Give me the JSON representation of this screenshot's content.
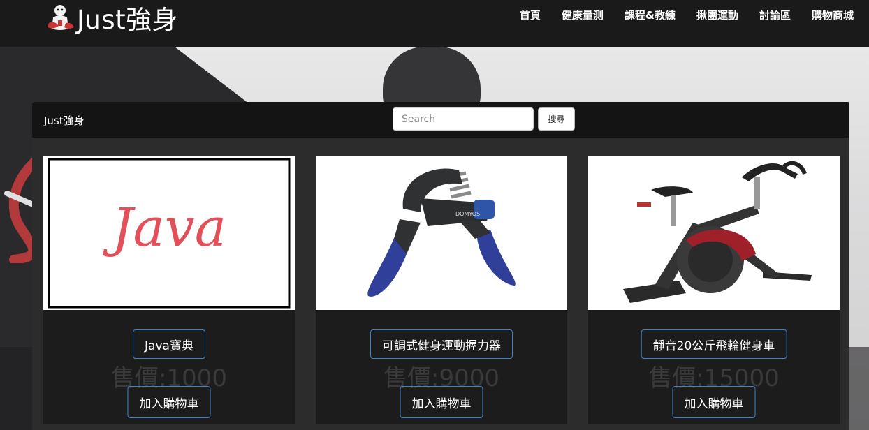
{
  "header": {
    "brand": "Just強身",
    "nav": [
      {
        "label": "首頁"
      },
      {
        "label": "健康量測"
      },
      {
        "label": "課程&教練"
      },
      {
        "label": "揪團運動"
      },
      {
        "label": "討論區"
      },
      {
        "label": "購物商城"
      }
    ]
  },
  "shop": {
    "brand": "Just強身",
    "search": {
      "placeholder": "Search",
      "value": ""
    },
    "search_button": "搜尋"
  },
  "products": [
    {
      "name": "Java寶典",
      "price": "售價:1000",
      "add_to_cart": "加入購物車",
      "image_text": "Java",
      "image": "java-book-cover"
    },
    {
      "name": "可調式健身運動握力器",
      "price": "售價:9000",
      "add_to_cart": "加入購物車",
      "image_text": "DOMYOS",
      "image": "hand-grip-strengthener"
    },
    {
      "name": "靜音20公斤飛輪健身車",
      "price": "售價:15000",
      "add_to_cart": "加入購物車",
      "image": "spin-bike"
    }
  ],
  "colors": {
    "nav_bg": "#1a1a1a",
    "button_border": "#3c82c8",
    "price_text": "#3a3a3a"
  }
}
